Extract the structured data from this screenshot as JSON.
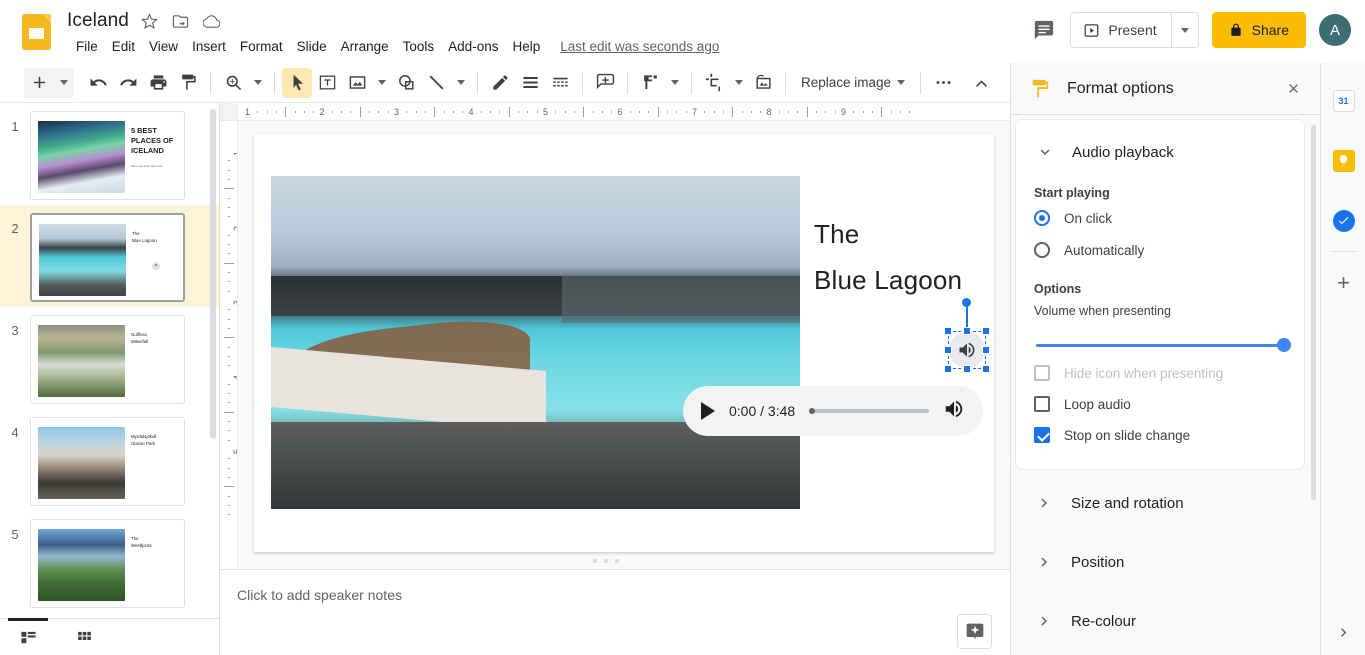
{
  "app": {
    "doc_title": "Iceland",
    "last_edit": "Last edit was seconds ago",
    "avatar_initial": "A"
  },
  "menus": [
    "File",
    "Edit",
    "View",
    "Insert",
    "Format",
    "Slide",
    "Arrange",
    "Tools",
    "Add-ons",
    "Help"
  ],
  "topbar": {
    "comment_icon": "comment-icon",
    "present_label": "Present",
    "present_icon": "present-play-icon",
    "share_label": "Share",
    "share_icon": "lock-icon"
  },
  "toolbar": {
    "replace_image_label": "Replace image",
    "items": [
      {
        "name": "new-slide-button",
        "icon": "plus-icon"
      },
      {
        "name": "new-slide-dropdown",
        "icon": "chevron-down-icon"
      },
      {
        "name": "undo-button",
        "icon": "undo-icon"
      },
      {
        "name": "redo-button",
        "icon": "redo-icon"
      },
      {
        "name": "print-button",
        "icon": "print-icon"
      },
      {
        "name": "paint-format-button",
        "icon": "paint-roller-icon"
      },
      {
        "name": "zoom-button",
        "icon": "magnifier-icon"
      },
      {
        "name": "zoom-dropdown",
        "icon": "chevron-down-icon"
      },
      {
        "name": "select-tool-button",
        "icon": "cursor-arrow-icon"
      },
      {
        "name": "text-box-button",
        "icon": "text-box-icon"
      },
      {
        "name": "insert-image-button",
        "icon": "image-icon"
      },
      {
        "name": "insert-image-dropdown",
        "icon": "chevron-down-icon"
      },
      {
        "name": "shape-button",
        "icon": "shape-icon"
      },
      {
        "name": "line-button",
        "icon": "line-icon"
      },
      {
        "name": "line-dropdown",
        "icon": "chevron-down-icon"
      },
      {
        "name": "pen-button",
        "icon": "pen-icon"
      },
      {
        "name": "layout-button",
        "icon": "lines-icon"
      },
      {
        "name": "theme-button",
        "icon": "theme-icon"
      },
      {
        "name": "transition-button",
        "icon": "transition-icon"
      },
      {
        "name": "format-options-button",
        "icon": "paint-format-icon"
      },
      {
        "name": "format-options-dropdown",
        "icon": "chevron-down-icon"
      },
      {
        "name": "crop-button",
        "icon": "crop-icon"
      },
      {
        "name": "crop-dropdown",
        "icon": "chevron-down-icon"
      },
      {
        "name": "mask-image-button",
        "icon": "mask-image-icon"
      },
      {
        "name": "more-options-button",
        "icon": "ellipsis-icon"
      },
      {
        "name": "collapse-toolbar-button",
        "icon": "chevron-up-icon"
      }
    ]
  },
  "ruler": {
    "horizontal_labels": [
      "1",
      "2",
      "3",
      "4",
      "5",
      "6",
      "7",
      "8",
      "9"
    ],
    "vertical_labels": [
      "1",
      "2",
      "3",
      "4",
      "5"
    ]
  },
  "filmstrip": {
    "slides": [
      {
        "number": "1",
        "title": "5 BEST PLACES OF ICELAND",
        "subtitle": "Must see and must visit",
        "selected": false,
        "has_audio": false,
        "style": "big"
      },
      {
        "number": "2",
        "title": "The\nBlue Lagoon",
        "subtitle": "",
        "selected": true,
        "has_audio": true,
        "style": "small"
      },
      {
        "number": "3",
        "title": "Gullfoss\nWaterfall",
        "subtitle": "",
        "selected": false,
        "has_audio": false,
        "style": "small"
      },
      {
        "number": "4",
        "title": "Myrdalsjökull\nGlacier Park",
        "subtitle": "",
        "selected": false,
        "has_audio": false,
        "style": "small"
      },
      {
        "number": "5",
        "title": "The\nWestfjords",
        "subtitle": "",
        "selected": false,
        "has_audio": false,
        "style": "small"
      }
    ],
    "view_filmstrip_icon": "filmstrip-view-icon",
    "view_grid_icon": "grid-view-icon"
  },
  "slide": {
    "title_line1": "The",
    "title_line2": "Blue Lagoon",
    "audio_icon": "speaker-icon"
  },
  "audio_player": {
    "play_icon": "play-icon",
    "time": "0:00 / 3:48",
    "volume_icon": "volume-icon",
    "progress_percent": 0
  },
  "notes": {
    "placeholder": "Click to add speaker notes",
    "explore_icon": "explore-sparkle-icon"
  },
  "format_options": {
    "title": "Format options",
    "header_icon": "paint-format-icon",
    "close_icon": "close-icon",
    "sections": {
      "audio_playback": {
        "label": "Audio playback",
        "expanded": true,
        "start_playing_label": "Start playing",
        "radios": [
          {
            "label": "On click",
            "selected": true
          },
          {
            "label": "Automatically",
            "selected": false
          }
        ],
        "options_label": "Options",
        "volume_label": "Volume when presenting",
        "volume_value": 100,
        "checkboxes": [
          {
            "label": "Hide icon when presenting",
            "checked": false,
            "disabled": true
          },
          {
            "label": "Loop audio",
            "checked": false,
            "disabled": false
          },
          {
            "label": "Stop on slide change",
            "checked": true,
            "disabled": false
          }
        ]
      },
      "collapsed": [
        {
          "label": "Size and rotation"
        },
        {
          "label": "Position"
        },
        {
          "label": "Re-colour"
        }
      ]
    }
  },
  "rail": {
    "items": [
      {
        "name": "google-calendar-icon",
        "label": "31"
      },
      {
        "name": "google-keep-icon",
        "label": ""
      },
      {
        "name": "google-tasks-icon",
        "label": ""
      }
    ],
    "add_label": "+",
    "expand_icon": "chevron-right-icon"
  },
  "colors": {
    "brand_yellow": "#f5b920",
    "share_yellow": "#fbbc04",
    "accent_blue": "#1a73e8",
    "slider_blue": "#4285f4",
    "selection_highlight": "#fdf3d7"
  }
}
